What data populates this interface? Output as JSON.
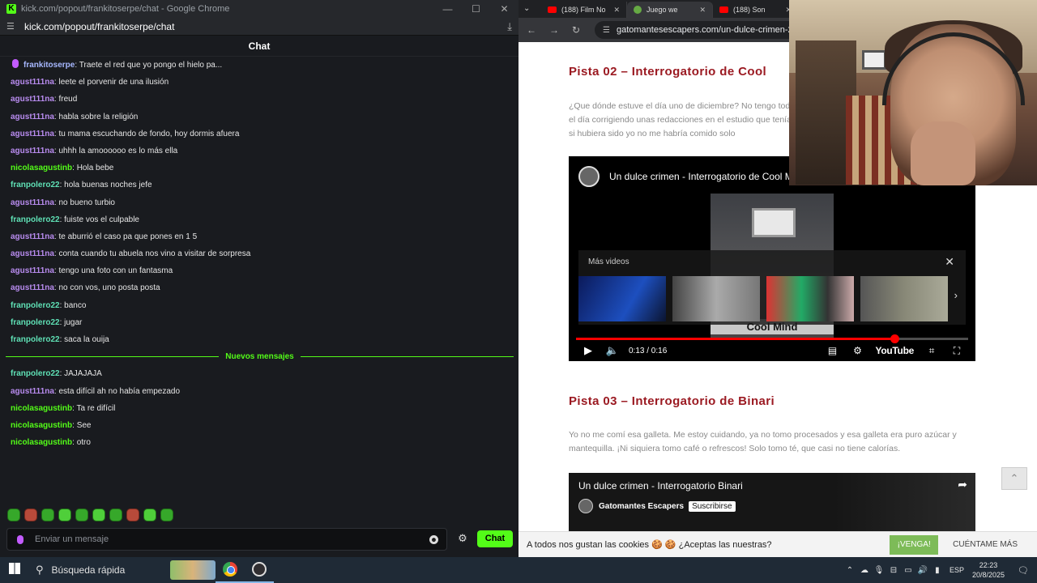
{
  "kick": {
    "window_title": "kick.com/popout/frankitoserpe/chat - Google Chrome",
    "url": "kick.com/popout/frankitoserpe/chat",
    "chat_title": "Chat",
    "messages": [
      {
        "user": "frankitoserpe",
        "text": "Traete el red que yo pongo el hielo pa..."
      },
      {
        "user": "agust111na",
        "text": "leete el porvenir de una ilusión"
      },
      {
        "user": "agust111na",
        "text": "freud"
      },
      {
        "user": "agust111na",
        "text": "habla sobre la religión"
      },
      {
        "user": "agust111na",
        "text": "tu mama escuchando de fondo, hoy dormis afuera"
      },
      {
        "user": "agust111na",
        "text": "uhhh la amoooooo es lo más ella"
      },
      {
        "user": "nicolasagustinb",
        "text": "Hola bebe"
      },
      {
        "user": "franpolero22",
        "text": "hola buenas noches jefe"
      },
      {
        "user": "agust111na",
        "text": "no bueno turbio"
      },
      {
        "user": "franpolero22",
        "text": "fuiste vos el culpable"
      },
      {
        "user": "agust111na",
        "text": "te aburrió el caso pa que pones en 1 5"
      },
      {
        "user": "agust111na",
        "text": "conta cuando tu abuela nos vino a visitar de sorpresa"
      },
      {
        "user": "agust111na",
        "text": "tengo una foto con un fantasma"
      },
      {
        "user": "agust111na",
        "text": "no con vos, uno posta posta"
      },
      {
        "user": "franpolero22",
        "text": "banco"
      },
      {
        "user": "franpolero22",
        "text": "jugar"
      },
      {
        "user": "franpolero22",
        "text": "saca la ouija"
      }
    ],
    "new_messages_label": "Nuevos mensajes",
    "new_messages": [
      {
        "user": "franpolero22",
        "text": "JAJAJAJA"
      },
      {
        "user": "agust111na",
        "text": "esta difícil ah no había empezado"
      },
      {
        "user": "nicolasagustinb",
        "text": "Ta re difícil"
      },
      {
        "user": "nicolasagustinb",
        "text": "See"
      },
      {
        "user": "nicolasagustinb",
        "text": "otro"
      }
    ],
    "input_placeholder": "Enviar un mensaje",
    "send_label": "Chat"
  },
  "browser": {
    "tabs": [
      {
        "title": "(188) Film No"
      },
      {
        "title": "Juego we"
      },
      {
        "title": "(188) Son"
      }
    ],
    "url": "gatomantesescapers.com/un-dulce-crimen-2/",
    "pista2_title": "Pista 02 – Interrogatorio de Cool",
    "pista2_text": "¿Que dónde estuve el día uno de diciembre? No tengo todo el día corrigiendo unas redacciones en el estudio que tenía, si hubiera sido yo no me habría comido solo",
    "video1": {
      "title": "Un dulce crimen - Interrogatorio de Cool Mind",
      "poster_label": "Cool Mind",
      "more_videos": "Más videos",
      "time": "0:13 / 0:16",
      "progress": 0.8125,
      "youtube": "YouTube"
    },
    "pista3_title": "Pista 03 – Interrogatorio de Binari",
    "pista3_text": "Yo no me comí esa galleta. Me estoy cuidando, ya no tomo procesados y esa galleta era puro azúcar y mantequilla. ¡Ni siquiera tomo café o refrescos! Solo tomo té, que casi no tiene calorías.",
    "video2": {
      "title": "Un dulce crimen - Interrogatorio Binari",
      "channel": "Gatomantes Escapers",
      "subscribe": "Suscribirse"
    },
    "cookie_text": "A todos nos gustan las cookies 🍪 🍪 ¿Aceptas las nuestras?",
    "cookie_accept": "¡VENGA!",
    "cookie_more": "CUÉNTAME MÁS"
  },
  "taskbar": {
    "search": "Búsqueda rápida",
    "lang": "ESP",
    "time": "22:23",
    "date": "20/8/2025"
  }
}
